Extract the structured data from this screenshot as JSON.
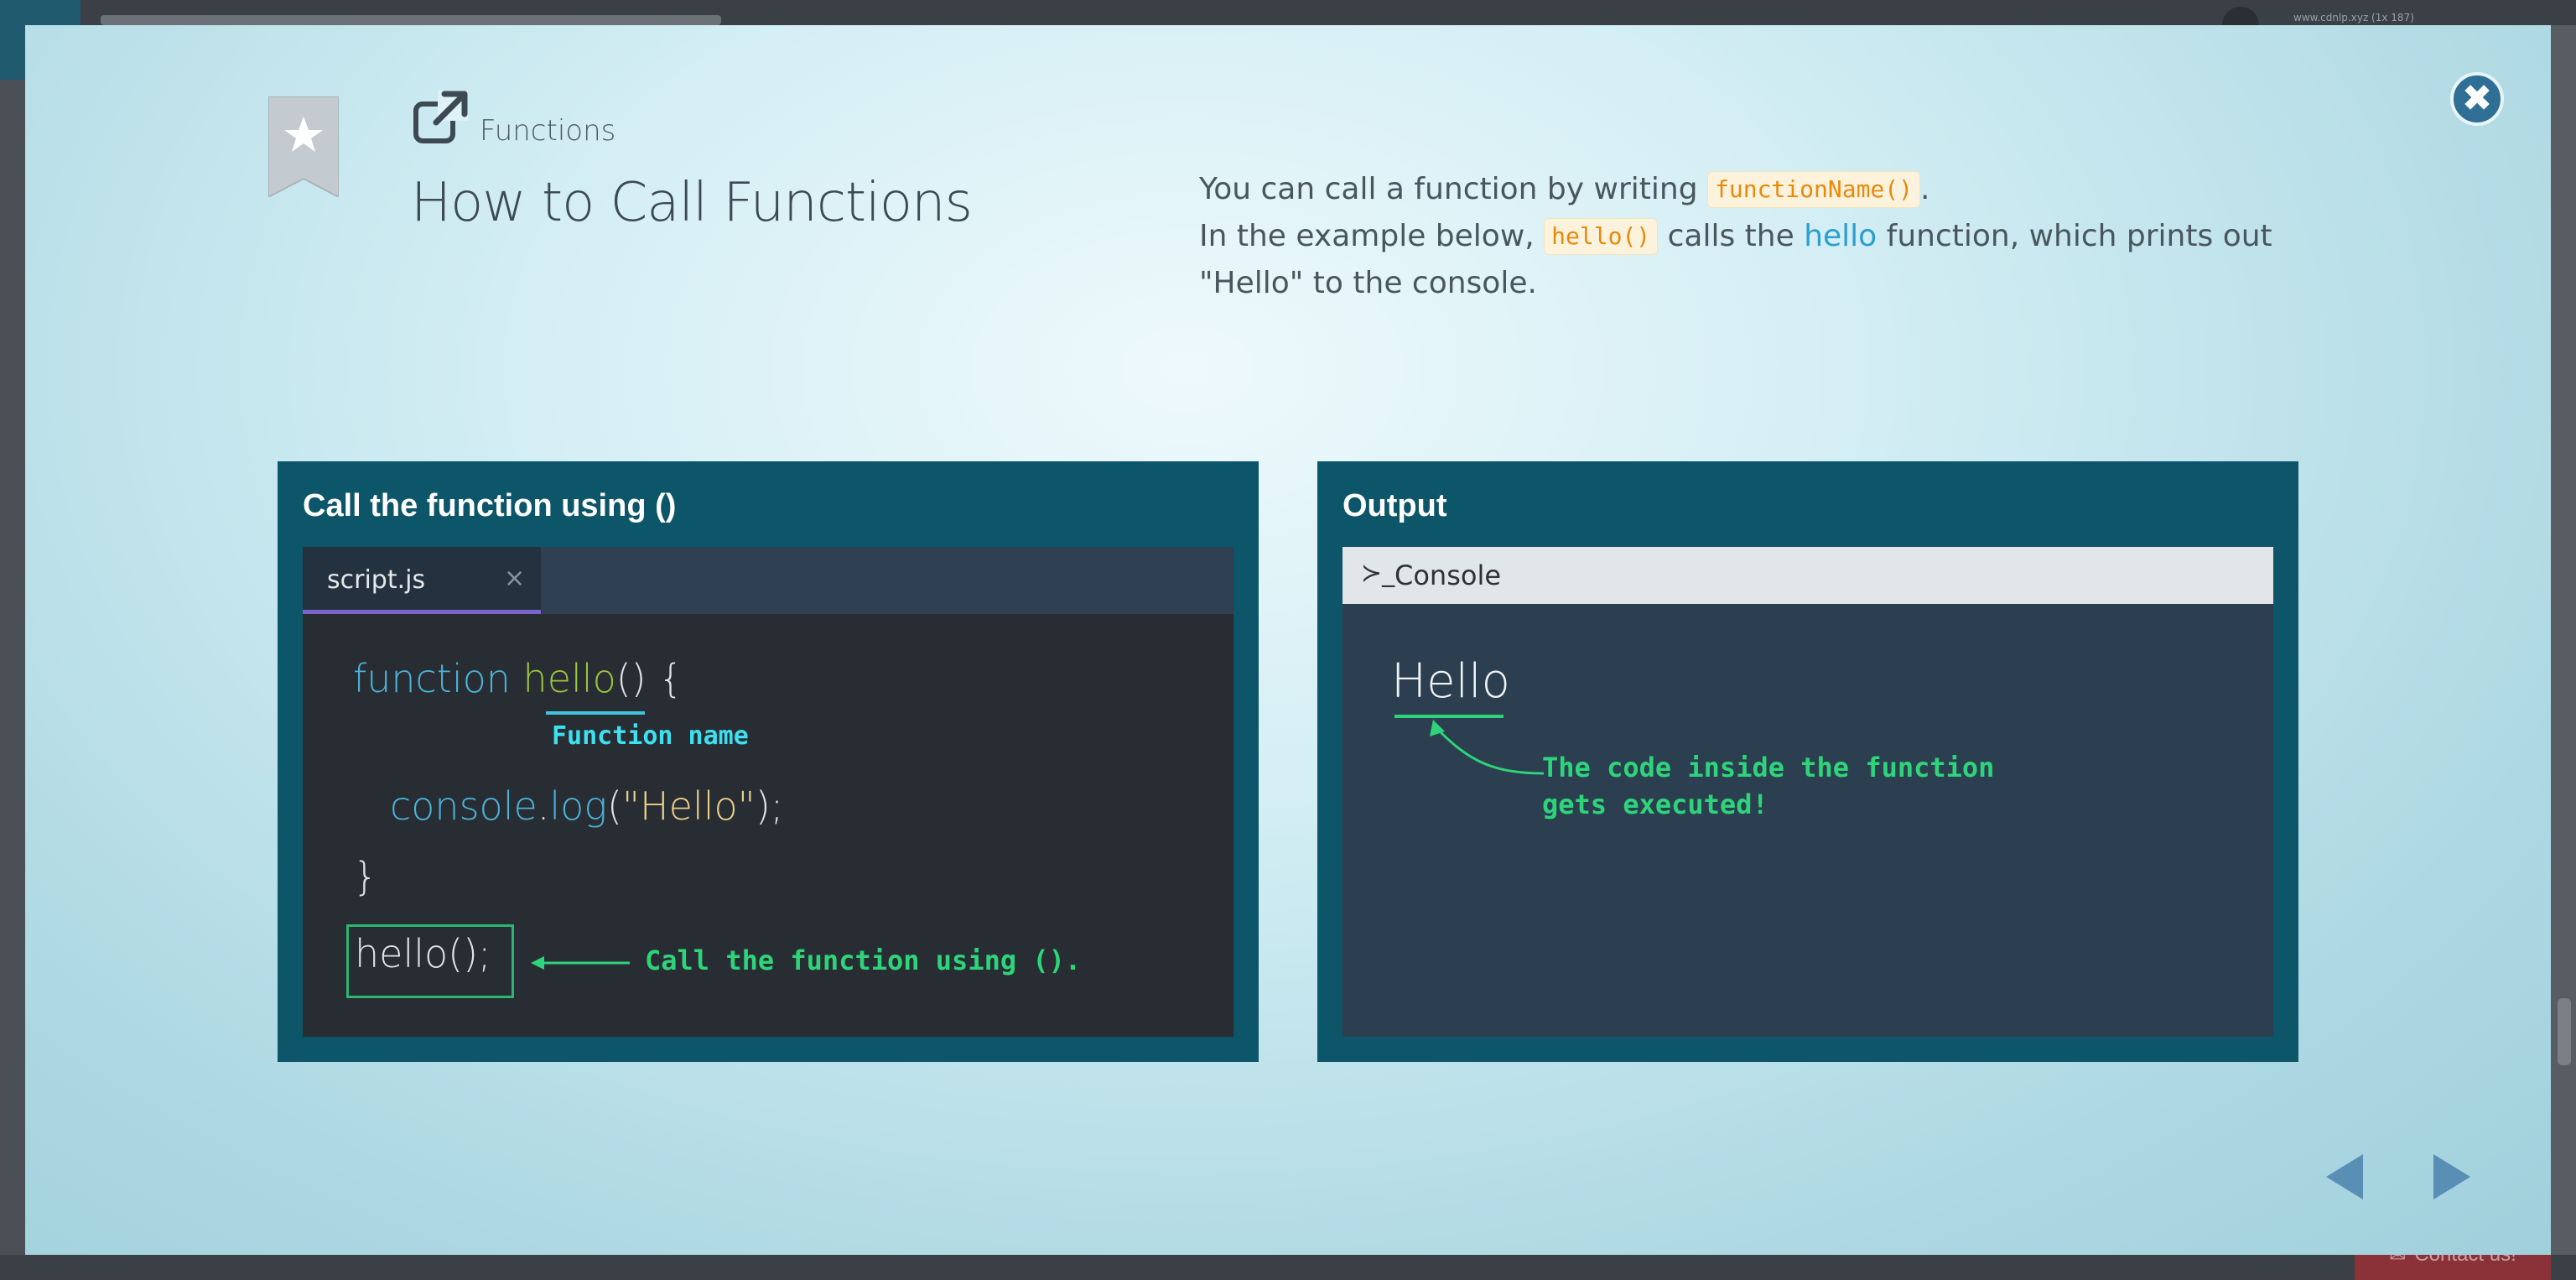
{
  "background": {
    "url_text": "www.cdnlp.xyz (1x 187)",
    "contact_label": "Contact us!"
  },
  "lesson": {
    "category": "Functions",
    "title": "How to Call Functions",
    "description": {
      "line1_before": "You can call a function by writing ",
      "line1_code": "functionName()",
      "line1_after": ".",
      "line2_before": "In the example below, ",
      "line2_code": "hello()",
      "line2_middle": " calls the ",
      "line2_highlight": "hello",
      "line2_after": " function, which prints out",
      "line3": "\"Hello\" to the console."
    },
    "close_label": "✖"
  },
  "code_panel": {
    "heading": "Call the function using ()",
    "tab_label": "script.js",
    "tab_close": "×",
    "code": {
      "keyword": "function",
      "fn_name": "hello",
      "signature_rest": "() {",
      "console_obj": "console",
      "dot": ".",
      "log_method": "log",
      "open_paren": "(",
      "string_literal": "\"Hello\"",
      "close_stmt": ");",
      "close_brace": "}",
      "call": "hello();"
    },
    "annotations": {
      "function_name": "Function name",
      "call_note": "Call the function using ()."
    }
  },
  "output_panel": {
    "heading": "Output",
    "console_prompt": "≻_",
    "console_title": "Console",
    "output_text": "Hello",
    "annotation_line1": "The code inside the function",
    "annotation_line2": "gets executed!"
  },
  "navigation": {
    "prev_label": "previous",
    "next_label": "next"
  },
  "colors": {
    "panel": "#0d5568",
    "editor_bg": "#282d33",
    "keyword": "#4ab3d8",
    "function_name": "#9bc43f",
    "string": "#e9d08a",
    "annotation_green": "#2ed47a",
    "annotation_cyan": "#3ee0f0",
    "inline_code": "#e8890c",
    "close_button": "#2f6f96"
  }
}
